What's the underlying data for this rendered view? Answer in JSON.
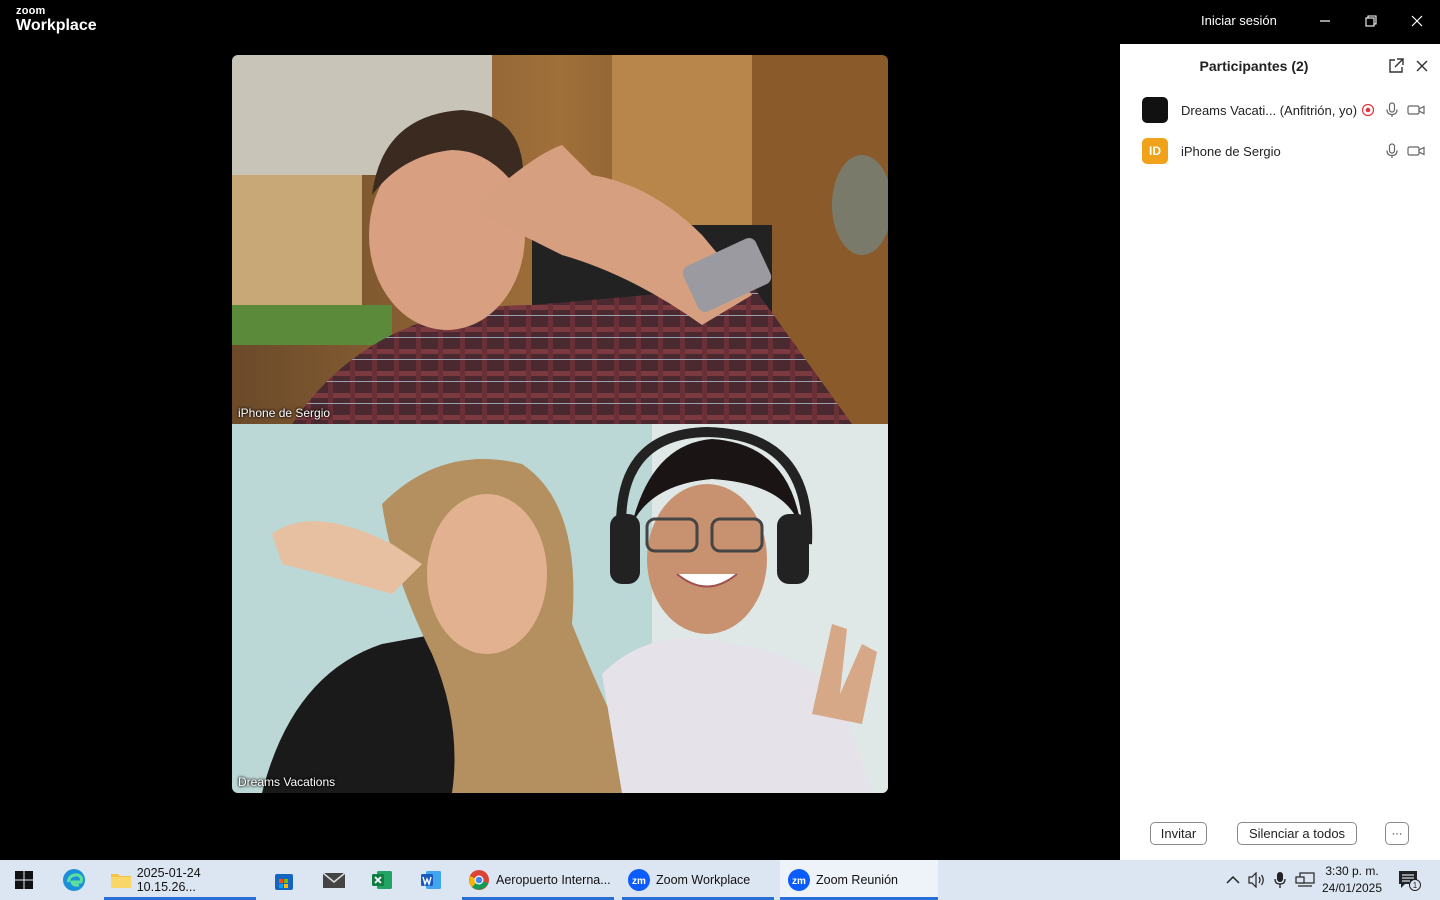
{
  "app": {
    "brand_small": "zoom",
    "brand_big": "Workplace",
    "signin_label": "Iniciar sesión"
  },
  "videos": [
    {
      "name": "iPhone de Sergio"
    },
    {
      "name": "Dreams Vacations"
    }
  ],
  "participants": {
    "title": "Participantes (2)",
    "list": [
      {
        "name": "Dreams Vacati... (Anfitrión, yo)",
        "avatar_text": "",
        "avatar_color": "#111111",
        "mic": "mic-icon",
        "video": "video-camera-icon",
        "recording": "recording-icon"
      },
      {
        "name": "iPhone de Sergio",
        "avatar_text": "ID",
        "avatar_color": "#f0a21b",
        "mic": "mic-icon",
        "video": "video-camera-icon"
      }
    ],
    "invite_label": "Invitar",
    "mute_all_label": "Silenciar a todos",
    "more_label": "···"
  },
  "taskbar": {
    "apps": [
      {
        "label": "2025-01-24 10.15.26...",
        "icon": "folder-icon"
      },
      {
        "label": "Aeropuerto Interna...",
        "icon": "chrome-icon"
      },
      {
        "label": "Zoom Workplace",
        "icon": "zoom-icon"
      },
      {
        "label": "Zoom Reunión",
        "icon": "zoom-icon"
      }
    ],
    "time": "3:30 p. m.",
    "date": "24/01/2025",
    "notification_count": "1"
  },
  "colors": {
    "accent": "#2a6fd6",
    "zoom_blue": "#0b5cff",
    "avatar_orange": "#f0a21b",
    "recording_red": "#e0383e"
  }
}
